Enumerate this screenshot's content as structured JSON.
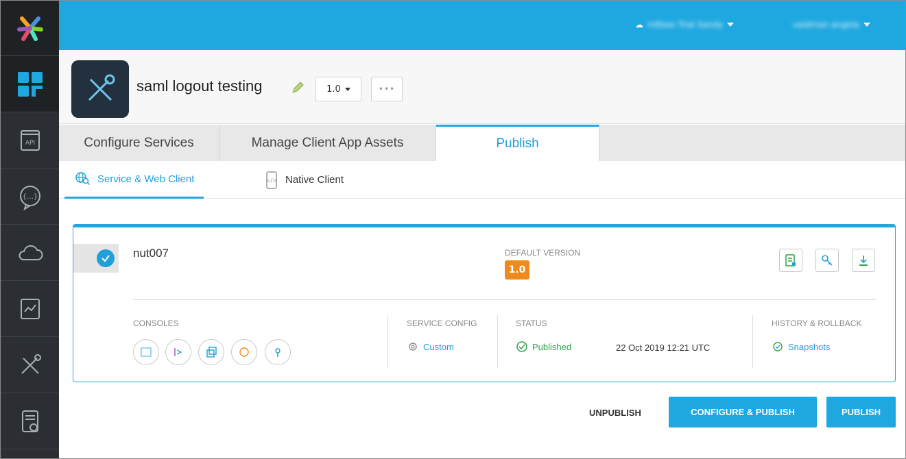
{
  "colors": {
    "accent": "#1fa8e0",
    "sidebar": "#2b2f33",
    "version_badge": "#f08a1c",
    "published": "#2ca44a"
  },
  "topbar": {
    "cloud_account": "mBaas Trial Sandy",
    "user_menu": "vaidman angela"
  },
  "app": {
    "title": "saml logout testing",
    "version": "1.0",
    "more_label": "•••"
  },
  "tabs": [
    {
      "label": "Configure Services"
    },
    {
      "label": "Manage Client App Assets"
    },
    {
      "label": "Publish"
    }
  ],
  "subtabs": [
    {
      "label": "Service & Web Client"
    },
    {
      "label": "Native Client"
    }
  ],
  "card": {
    "service_name": "nut007",
    "default_version_label": "DEFAULT VERSION",
    "default_version": "1.0",
    "consoles_label": "CONSOLES",
    "service_config_label": "SERVICE CONFIG",
    "service_config_value": "Custom",
    "status_label": "STATUS",
    "status_value": "Published",
    "timestamp": "22 Oct 2019 12:21 UTC",
    "history_label": "HISTORY & ROLLBACK",
    "history_value": "Snapshots"
  },
  "actions": {
    "unpublish": "UNPUBLISH",
    "configure_publish": "CONFIGURE & PUBLISH",
    "publish": "PUBLISH"
  }
}
